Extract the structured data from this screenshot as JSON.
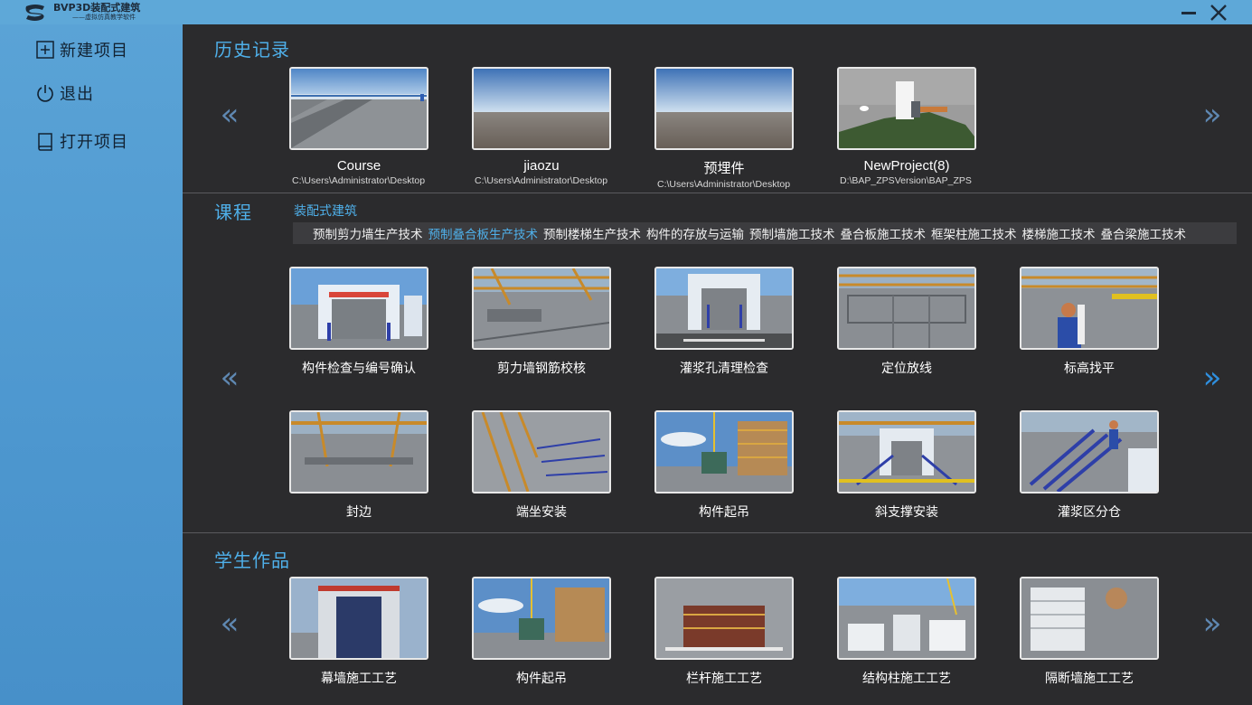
{
  "app": {
    "title": "BVP3D装配式建筑",
    "subtitle": "——虚拟仿真教学软件"
  },
  "sidebar": {
    "items": [
      {
        "label": "新建项目",
        "icon": "plus-square-icon"
      },
      {
        "label": "退出",
        "icon": "power-icon"
      },
      {
        "label": "打开项目",
        "icon": "book-icon"
      }
    ]
  },
  "history": {
    "title": "历史记录",
    "items": [
      {
        "name": "Course",
        "path": "C:\\Users\\Administrator\\Desktop"
      },
      {
        "name": "jiaozu",
        "path": "C:\\Users\\Administrator\\Desktop"
      },
      {
        "name": "预埋件",
        "path": "C:\\Users\\Administrator\\Desktop"
      },
      {
        "name": "NewProject(8)",
        "path": "D:\\BAP_ZPSVersion\\BAP_ZPS"
      }
    ]
  },
  "courses": {
    "title": "课程",
    "category": "装配式建筑",
    "tabs": [
      {
        "label": "预制剪力墙生产技术",
        "active": false
      },
      {
        "label": "预制叠合板生产技术",
        "active": true
      },
      {
        "label": "预制楼梯生产技术",
        "active": false
      },
      {
        "label": "构件的存放与运输",
        "active": false
      },
      {
        "label": "预制墙施工技术",
        "active": false
      },
      {
        "label": "叠合板施工技术",
        "active": false
      },
      {
        "label": "框架柱施工技术",
        "active": false
      },
      {
        "label": "楼梯施工技术",
        "active": false
      },
      {
        "label": "叠合梁施工技术",
        "active": false
      }
    ],
    "row1": [
      "构件检查与编号确认",
      "剪力墙钢筋校核",
      "灌浆孔清理检查",
      "定位放线",
      "标高找平"
    ],
    "row2": [
      "封边",
      "端坐安装",
      "构件起吊",
      "斜支撑安装",
      "灌浆区分仓"
    ]
  },
  "works": {
    "title": "学生作品",
    "items": [
      "幕墙施工工艺",
      "构件起吊",
      "栏杆施工工艺",
      "结构柱施工工艺",
      "隔断墙施工工艺"
    ]
  },
  "icons": {
    "prev": "«",
    "next": "»"
  },
  "colors": {
    "accent": "#4fb0ea",
    "sidebar": "#5aa3d6",
    "background": "#2b2b2d"
  }
}
